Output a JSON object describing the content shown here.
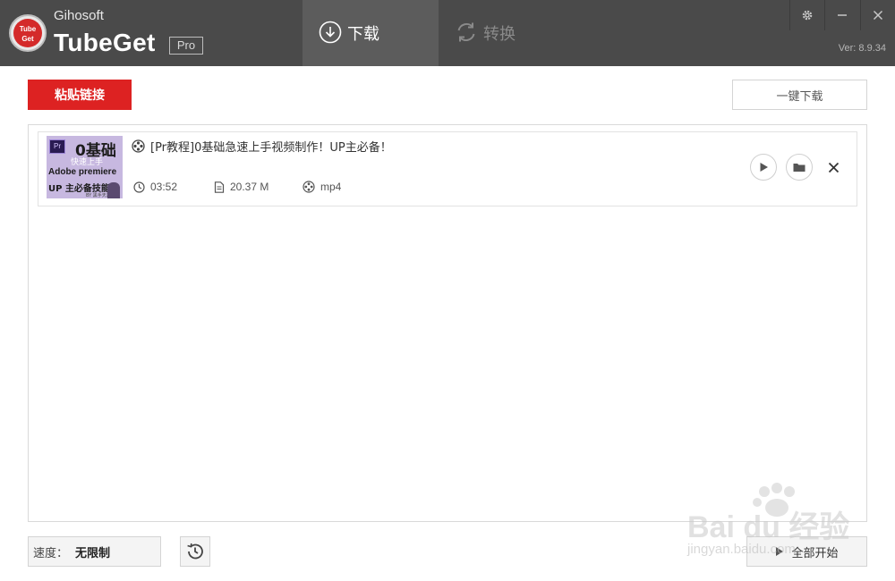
{
  "app": {
    "vendor": "Gihosoft",
    "name": "TubeGet",
    "edition": "Pro",
    "logo_text_top": "Tube",
    "logo_text_bottom": "Get",
    "version": "Ver: 8.9.34"
  },
  "tabs": [
    {
      "label": "下载",
      "icon": "download-circle-icon",
      "active": true
    },
    {
      "label": "转换",
      "icon": "convert-cycle-icon",
      "active": false
    }
  ],
  "window_controls": {
    "settings": "gear-icon",
    "minimize": "minimize-icon",
    "close": "close-icon"
  },
  "toolbar": {
    "paste_label": "粘贴链接",
    "one_click_label": "一键下载"
  },
  "downloads": [
    {
      "title": "[Pr教程]0基础急速上手视频制作！UP主必备！",
      "duration": "03:52",
      "size": "20.37 M",
      "format": "mp4",
      "thumbnail": {
        "pr_logo": "Pr",
        "headline": "0基础",
        "subline": "快速上手",
        "line2": "Adobe premiere",
        "line3": "UP 主必备技能",
        "tiny": "BY 黑手天黑"
      }
    }
  ],
  "footer": {
    "speed_label": "速度：",
    "speed_value": "无限制",
    "start_all_label": "全部开始"
  },
  "watermark": {
    "text": "Bai du 经验",
    "sub": "jingyan.baidu.com"
  },
  "colors": {
    "titlebar": "#4a4a4a",
    "active_tab": "#5c5c5c",
    "accent_red": "#dd2222"
  }
}
